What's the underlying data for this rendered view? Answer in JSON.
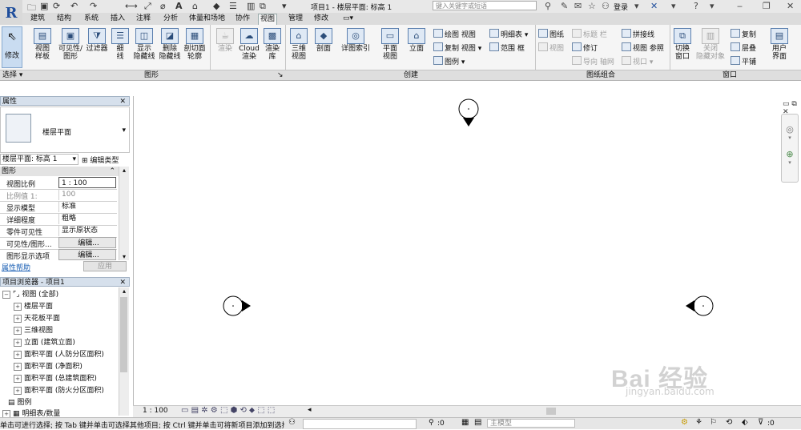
{
  "app": {
    "title": "项目1 - 楼层平面: 标高 1",
    "logo": "R",
    "search_placeholder": "键入关键字或短语",
    "login_label": "登录"
  },
  "quick_access": [
    "open-icon",
    "save-icon",
    "sync-icon",
    "undo-icon",
    "redo-icon",
    "measure-icon",
    "dimension-icon",
    "text-A-icon",
    "3d-icon",
    "section-icon",
    "thin-lines-icon",
    "close-hidden-icon",
    "switch-windows-icon"
  ],
  "tabs": [
    "建筑",
    "结构",
    "系统",
    "插入",
    "注释",
    "分析",
    "体量和场地",
    "协作",
    "视图",
    "管理",
    "修改"
  ],
  "active_tab": "视图",
  "ribbon": {
    "modify": "修改",
    "graphics": [
      "视图\n样板",
      "可见性/\n图形",
      "过滤器",
      "细\n线",
      "显示\n隐藏线",
      "删除\n隐藏线",
      "剖切面\n轮廓"
    ],
    "render": [
      "渲染",
      "Cloud\n渲染",
      "渲染\n库"
    ],
    "create_large": [
      "三维\n视图",
      "剖面",
      "详图索引",
      "平面\n视图",
      "立面"
    ],
    "create_small": [
      "绘图 视图",
      "复制 视图",
      "图例",
      "明细表",
      "范围 框"
    ],
    "sheet_small": [
      "图纸",
      "视图",
      "标题 栏",
      "修订",
      "导向 轴网",
      "拼接线",
      "视图 参照",
      "视口"
    ],
    "window_large": [
      "切换\n窗口",
      "关闭\n隐藏对象",
      "用户\n界面"
    ],
    "window_small": [
      "复制",
      "层叠",
      "平铺"
    ],
    "groups": [
      "选择 ▾",
      "图形",
      "创建",
      "图纸组合",
      "窗口"
    ]
  },
  "properties": {
    "title": "属性",
    "type_name": "楼层平面",
    "selector": "楼层平面: 标高 1",
    "edit_type": "编辑类型",
    "section": "图形",
    "rows": [
      {
        "k": "视图比例",
        "v": "1 : 100"
      },
      {
        "k": "比例值 1:",
        "v": "100"
      },
      {
        "k": "显示模型",
        "v": "标准"
      },
      {
        "k": "详细程度",
        "v": "粗略"
      },
      {
        "k": "零件可见性",
        "v": "显示原状态"
      },
      {
        "k": "可见性/图形...",
        "v": "编辑..."
      },
      {
        "k": "图形显示选项",
        "v": "编辑..."
      }
    ],
    "help": "属性帮助",
    "apply": "应用"
  },
  "browser": {
    "title": "项目浏览器 - 项目1",
    "root": "视图 (全部)",
    "items": [
      "楼层平面",
      "天花板平面",
      "三维视图",
      "立面 (建筑立面)",
      "面积平面 (人防分区面积)",
      "面积平面 (净面积)",
      "面积平面 (总建筑面积)",
      "面积平面 (防火分区面积)"
    ],
    "legend": "图例",
    "schedule": "明细表/数量"
  },
  "view_controls": {
    "scale": "1 : 100"
  },
  "status": {
    "hint": "单击可进行选择; 按 Tab 键并单击可选择其他项目; 按 Ctrl 键并单击可将新项目添加到选择",
    "count": ":0",
    "model": "主模型",
    "filter_count": ":0"
  },
  "watermark": {
    "brand": "Bai  经验",
    "url": "jingyan.baidu.com"
  },
  "colors": {
    "accent": "#1f4e9c",
    "panel_header": "#d6e0ec",
    "active_button": "#c9dcf1"
  }
}
